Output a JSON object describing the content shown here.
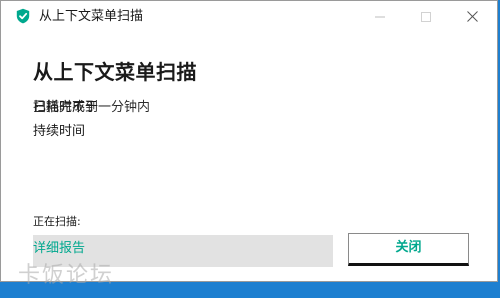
{
  "window": {
    "title": "从上下文菜单扫描",
    "icon": "kaspersky-shield-icon",
    "accent_color": "#00a88e"
  },
  "main": {
    "heading": "从上下文菜单扫描",
    "status_text_a": "扫描完成于",
    "status_text_b": "已耗时不到一分钟内",
    "duration_label": "持续时间",
    "scanning_label": "正在扫描:",
    "report_link": "详细报告",
    "close_button": "关闭"
  },
  "watermark": {
    "text": "卡饭论坛"
  }
}
